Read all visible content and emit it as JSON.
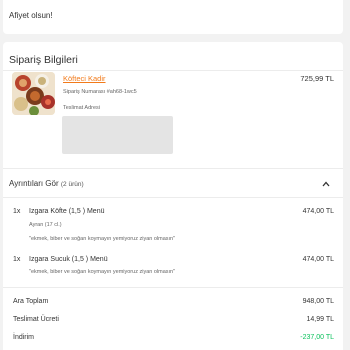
{
  "greeting": "Afiyet olsun!",
  "order_info": {
    "title": "Sipariş Bilgileri",
    "restaurant": "Köfteci Kadir",
    "price": "725,99 TL",
    "order_number": "Sipariş Numarası #ah68-1wc5",
    "address_label": "Teslimat Adresi"
  },
  "details": {
    "toggle_label": "Ayrıntıları Gör",
    "count": "(2 ürün)",
    "icon": "chevron-up-icon",
    "items": [
      {
        "qty": "1x",
        "name": "Izgara Köfte (1,5 ) Menü",
        "price": "474,00 TL",
        "extra": "Ayran (17 cl.)",
        "note": "\"ekmek, biber ve soğan koymayın yemiyoruz ziyan olmasın\""
      },
      {
        "qty": "1x",
        "name": "Izgara Sucuk (1,5 ) Menü",
        "price": "474,00 TL",
        "note": "\"ekmek, biber ve soğan koymayın yemiyoruz ziyan olmasın\""
      }
    ]
  },
  "summary": {
    "subtotal_label": "Ara Toplam",
    "subtotal_value": "948,00 TL",
    "delivery_label": "Teslimat Ücreti",
    "delivery_value": "14,99 TL",
    "discount_label": "İndirim",
    "discount_value": "-237,00 TL"
  },
  "colors": {
    "accent": "#f27a1a",
    "discount": "#0bc15c",
    "background": "#f2f2f2"
  }
}
